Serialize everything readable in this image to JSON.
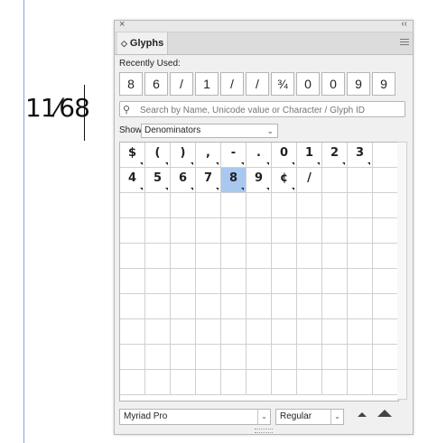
{
  "document": {
    "fraction_text": "11⁄68"
  },
  "panel": {
    "close_glyph": "×",
    "collapse_glyph": "‹‹",
    "tab_arrows": "◇",
    "tab_title": "Glyphs",
    "recently_used_label": "Recently Used:",
    "recent_glyphs": [
      "8",
      "6",
      "/",
      "1",
      "/",
      "/",
      "¾",
      "0",
      "0",
      "9",
      "9"
    ],
    "search_placeholder": "Search by Name, Unicode value or Character / Glyph ID",
    "show_label": "Show:",
    "show_value": "Denominators",
    "glyph_grid": {
      "row1": [
        "$",
        "(",
        ")",
        ",",
        "-",
        ".",
        "0",
        "1",
        "2",
        "3",
        ""
      ],
      "row2": [
        "4",
        "5",
        "6",
        "7",
        "8",
        "9",
        "¢",
        "/",
        "",
        "",
        ""
      ],
      "selected_glyph": "8"
    },
    "font_family": "Myriad Pro",
    "font_style": "Regular",
    "icons": [
      "search-icon",
      "chevron-down-icon",
      "panel-menu-icon",
      "zoom-out-icon",
      "zoom-in-icon"
    ]
  }
}
